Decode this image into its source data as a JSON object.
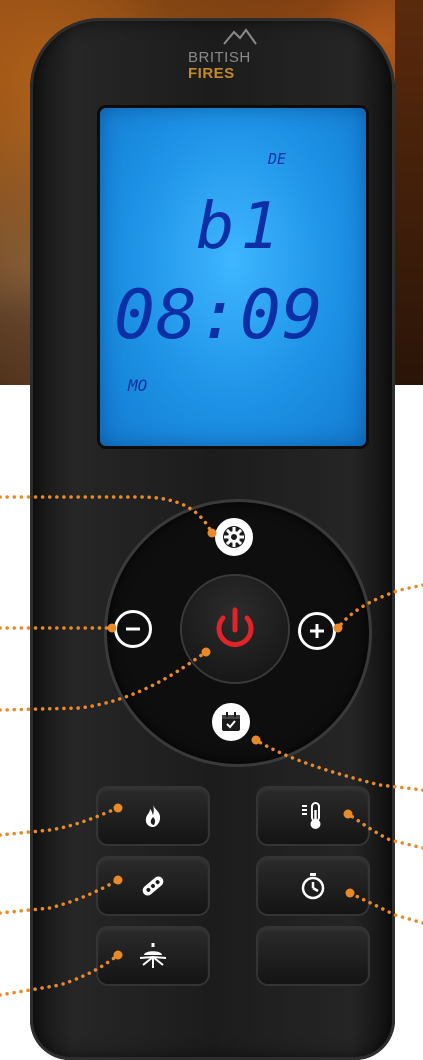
{
  "brand": {
    "line1": "BRITISH",
    "line2": "FIRES"
  },
  "display": {
    "top_indicator": "DE",
    "program": "b1",
    "time": "08:09",
    "day": "MO"
  },
  "colors": {
    "lcd": "#1d92e6",
    "lcd_text": "#0c2fa6",
    "pointer": "#e88a2a",
    "power": "#e0242a"
  },
  "icons": {
    "settings": "gear-icon",
    "minus": "minus-icon",
    "plus": "plus-icon",
    "power": "power-icon",
    "calendar": "calendar-icon",
    "flame": "flame-icon",
    "thermometer": "thermometer-icon",
    "logs": "logs-icon",
    "timer": "timer-icon",
    "light": "light-icon"
  }
}
